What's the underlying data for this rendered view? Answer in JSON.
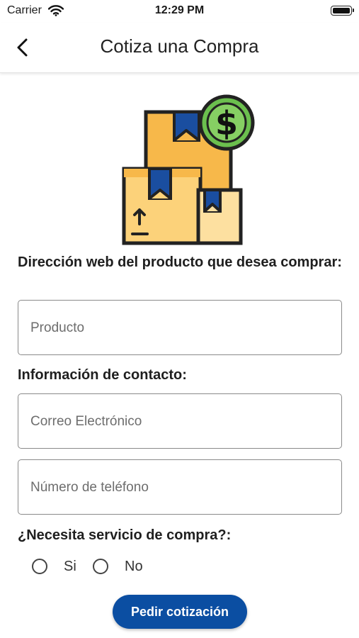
{
  "status_bar": {
    "carrier": "Carrier",
    "time": "12:29 PM"
  },
  "header": {
    "title": "Cotiza una Compra"
  },
  "icons": {
    "back": "chevron-left-icon",
    "illustration": "boxes-with-dollar-icon",
    "wifi": "wifi-icon",
    "battery": "battery-icon"
  },
  "form": {
    "product_label": "Dirección web del producto que desea comprar:",
    "product_placeholder": "Producto",
    "contact_label": "Información de contacto:",
    "email_placeholder": "Correo Electrónico",
    "phone_placeholder": "Número de teléfono",
    "service_label": "¿Necesita servicio de compra?:",
    "options": [
      "Si",
      "No"
    ],
    "submit_label": "Pedir cotización"
  },
  "colors": {
    "primary": "#0b4ea2",
    "box_orange": "#f7b84a",
    "box_light": "#fcd27a",
    "ribbon_blue": "#1a4ea0",
    "coin_green": "#6bbf4e"
  }
}
